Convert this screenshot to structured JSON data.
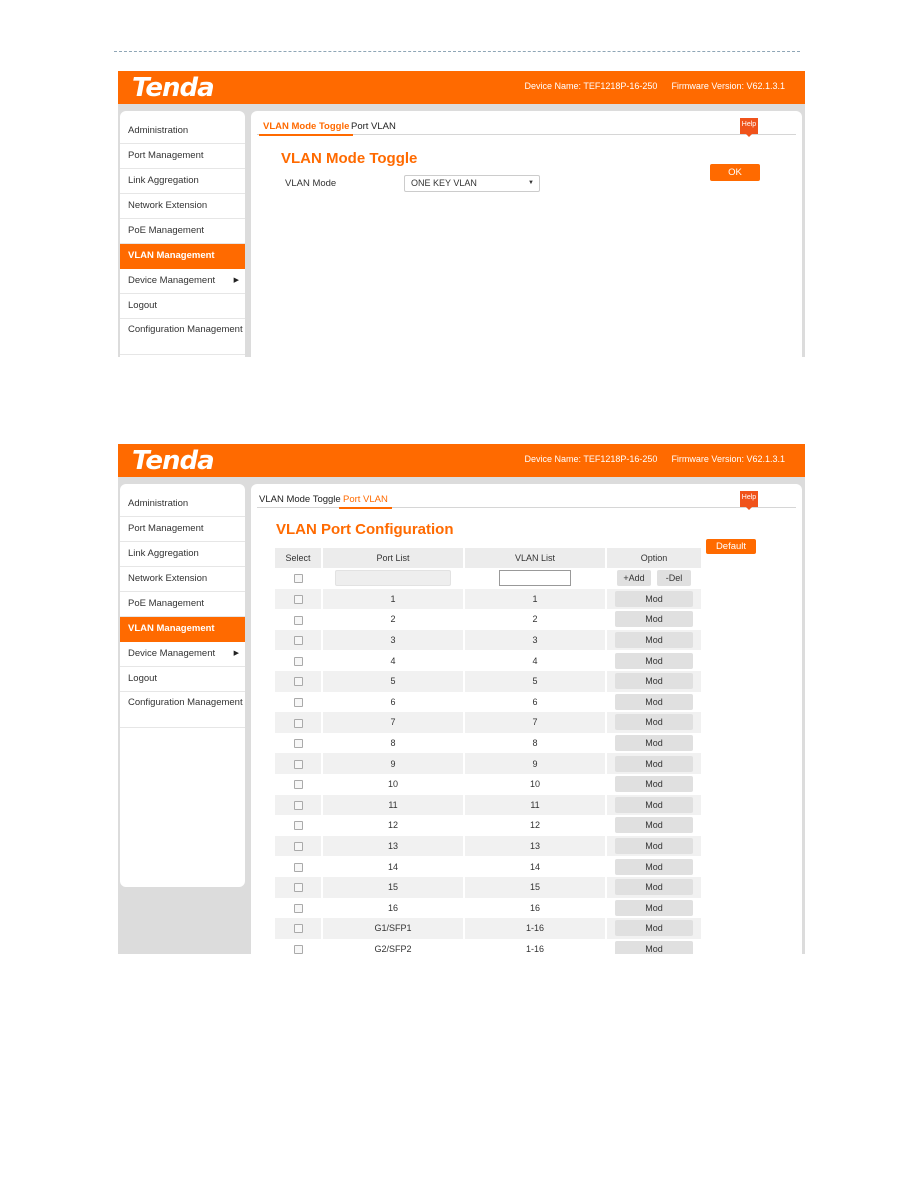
{
  "header": {
    "logo": "Tenda",
    "device_name": "Device Name: TEF1218P-16-250",
    "firmware_version": "Firmware Version: V62.1.3.1"
  },
  "sidebar": {
    "items": [
      {
        "label": "Administration"
      },
      {
        "label": "Port Management"
      },
      {
        "label": "Link Aggregation"
      },
      {
        "label": "Network Extension"
      },
      {
        "label": "PoE Management"
      },
      {
        "label": "VLAN Management",
        "active": true
      },
      {
        "label": "Device Management",
        "has_submenu": true
      },
      {
        "label": "Logout"
      },
      {
        "label": "Configuration Management"
      }
    ]
  },
  "tabs": {
    "mode_toggle": "VLAN Mode Toggle",
    "port_vlan": "Port VLAN"
  },
  "help_label": "Help",
  "screen1": {
    "active_tab": "VLAN Mode Toggle",
    "title": "VLAN Mode Toggle",
    "vlan_mode_label": "VLAN Mode",
    "vlan_mode_value": "ONE KEY VLAN",
    "ok_label": "OK"
  },
  "screen2": {
    "active_tab": "Port VLAN",
    "title": "VLAN Port Configuration",
    "default_label": "Default",
    "columns": {
      "select": "Select",
      "port_list": "Port List",
      "vlan_list": "VLAN List",
      "option": "Option"
    },
    "new_row": {
      "port_list_value": "",
      "vlan_list_value": "",
      "add_label": "+Add",
      "del_label": "-Del"
    },
    "mod_label": "Mod",
    "rows": [
      {
        "port": "1",
        "vlan": "1"
      },
      {
        "port": "2",
        "vlan": "2"
      },
      {
        "port": "3",
        "vlan": "3"
      },
      {
        "port": "4",
        "vlan": "4"
      },
      {
        "port": "5",
        "vlan": "5"
      },
      {
        "port": "6",
        "vlan": "6"
      },
      {
        "port": "7",
        "vlan": "7"
      },
      {
        "port": "8",
        "vlan": "8"
      },
      {
        "port": "9",
        "vlan": "9"
      },
      {
        "port": "10",
        "vlan": "10"
      },
      {
        "port": "11",
        "vlan": "11"
      },
      {
        "port": "12",
        "vlan": "12"
      },
      {
        "port": "13",
        "vlan": "13"
      },
      {
        "port": "14",
        "vlan": "14"
      },
      {
        "port": "15",
        "vlan": "15"
      },
      {
        "port": "16",
        "vlan": "16"
      },
      {
        "port": "G1/SFP1",
        "vlan": "1-16"
      },
      {
        "port": "G2/SFP2",
        "vlan": "1-16"
      }
    ]
  }
}
